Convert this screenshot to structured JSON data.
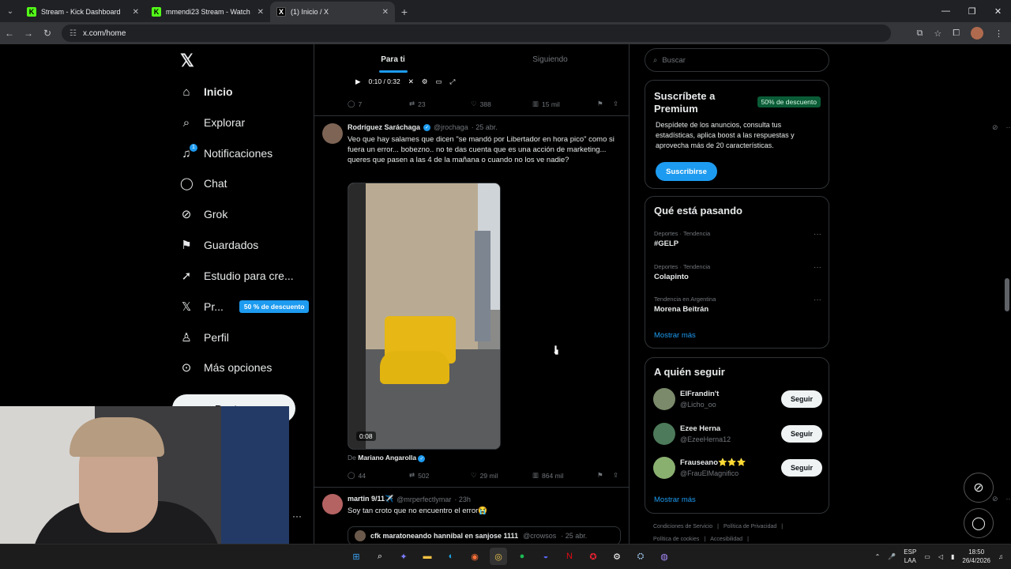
{
  "browser": {
    "tabs": [
      {
        "title": "Stream - Kick Dashboard",
        "icon": "kick-icon",
        "active": false
      },
      {
        "title": "mmendi23 Stream - Watch Live",
        "icon": "kick-icon",
        "active": false
      },
      {
        "title": "(1) Inicio / X",
        "icon": "x-icon",
        "active": true
      }
    ],
    "url": "x.com/home"
  },
  "nav": {
    "items": [
      {
        "label": "Inicio",
        "icon": "home-icon"
      },
      {
        "label": "Explorar",
        "icon": "search-icon"
      },
      {
        "label": "Notificaciones",
        "icon": "bell-icon",
        "badge": "1"
      },
      {
        "label": "Chat",
        "icon": "chat-icon"
      },
      {
        "label": "Grok",
        "icon": "grok-icon"
      },
      {
        "label": "Guardados",
        "icon": "bookmark-icon"
      },
      {
        "label": "Estudio para cre...",
        "icon": "rocket-icon"
      },
      {
        "label": "Pr...",
        "icon": "x-icon",
        "pill": "50 % de descuento"
      },
      {
        "label": "Perfil",
        "icon": "person-icon"
      },
      {
        "label": "Más opciones",
        "icon": "more-circle-icon"
      }
    ],
    "post_button": "Postear"
  },
  "feed": {
    "tabs": [
      "Para ti",
      "Siguiendo"
    ],
    "video_time": "0:10 / 0:32",
    "prev_actions": {
      "replies": "7",
      "reposts": "23",
      "likes": "388",
      "views": "15 mil"
    },
    "post1": {
      "name": "Rodríguez Saráchaga",
      "handle": "@jrochaga",
      "time": "· 25 abr.",
      "text": "Veo que hay salames que dicen \"se mandó por Libertador en hora pico\" como si fuera un error... bobezno.. no te das cuenta que es una acción de marketing... queres que pasen a las 4 de la mañana o cuando no los ve nadie?",
      "media_duration": "0:08",
      "attribution_prefix": "De",
      "attribution_name": "Mariano Angarolla",
      "actions": {
        "replies": "44",
        "reposts": "502",
        "likes": "29 mil",
        "views": "864 mil"
      }
    },
    "post2": {
      "name": "martin 9/11✈️",
      "handle": "@mrperfectlymar",
      "time": "· 23h",
      "text": "Soy tan croto que no encuentro el error😭",
      "quote_name": "cfk maratoneando hannibal en sanjose 1111",
      "quote_handle": "@crowsos",
      "quote_time": "· 25 abr."
    }
  },
  "sidebar": {
    "search_placeholder": "Buscar",
    "premium": {
      "title": "Suscríbete a Premium",
      "badge": "50% de descuento",
      "desc": "Despídete de los anuncios, consulta tus estadísticas, aplica boost a las respuestas y aprovecha más de 20 características.",
      "button": "Suscribirse"
    },
    "trends": {
      "title": "Qué está pasando",
      "items": [
        {
          "category": "Deportes · Tendencia",
          "name": "#GELP"
        },
        {
          "category": "Deportes · Tendencia",
          "name": "Colapinto"
        },
        {
          "category": "Tendencia en Argentina",
          "name": "Morena Beitrán"
        }
      ],
      "more": "Mostrar más"
    },
    "follow": {
      "title": "A quién seguir",
      "items": [
        {
          "name": "ElFrandin't",
          "handle": "@Licho_oo",
          "button": "Seguir",
          "color": "#7a8a6a"
        },
        {
          "name": "Ezee Herna",
          "handle": "@EzeeHerna12",
          "button": "Seguir",
          "color": "#4d7a5a"
        },
        {
          "name": "Frauseano⭐⭐⭐",
          "handle": "@FrauElMagnifico",
          "button": "Seguir",
          "color": "#8ab070"
        }
      ],
      "more": "Mostrar más"
    },
    "footer": [
      "Condiciones de Servicio",
      "|",
      "Política de Privacidad",
      "|",
      "Política de cookies",
      "|",
      "Accesibilidad",
      "|"
    ]
  },
  "taskbar": {
    "lang_top": "ESP",
    "lang_bottom": "LAA",
    "time": "18:50",
    "date": "26/4/2026"
  }
}
